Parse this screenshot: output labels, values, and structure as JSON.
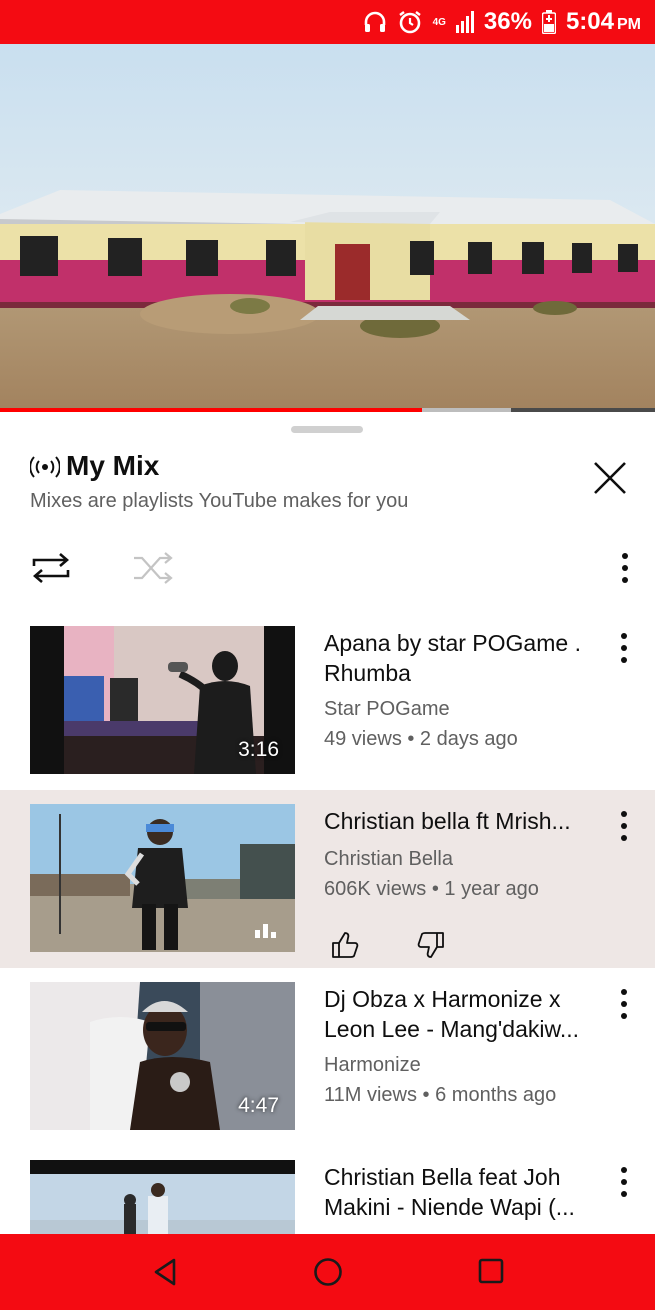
{
  "status_bar": {
    "network": "4G",
    "battery": "36%",
    "time": "5:04",
    "ampm": "PM",
    "icons": [
      "headphones-icon",
      "alarm-icon",
      "signal-icon",
      "battery-charging-icon"
    ]
  },
  "player": {
    "progress": 0.645,
    "buffered_to": 0.78,
    "colors": {
      "progress": "#ff0000",
      "accent_bar": "#f40b12"
    }
  },
  "mix": {
    "title": "My Mix",
    "subtitle": "Mixes are playlists YouTube makes for you",
    "icons": [
      "broadcast-icon",
      "close-icon",
      "repeat-icon",
      "shuffle-icon",
      "more-vert-icon"
    ]
  },
  "playlist": [
    {
      "title": "Apana by star POGame . Rhumba",
      "channel": "Star POGame",
      "meta": "49 views • 2 days ago",
      "duration": "3:16",
      "active": false
    },
    {
      "title": "Christian bella ft Mrish...",
      "channel": "Christian Bella",
      "meta": "606K views • 1 year ago",
      "duration": "",
      "active": true
    },
    {
      "title": "Dj Obza x Harmonize x Leon Lee - Mang'dakiw...",
      "channel": "Harmonize",
      "meta": "11M views • 6 months ago",
      "duration": "4:47",
      "active": false
    },
    {
      "title": "Christian Bella feat Joh Makini - Niende Wapi (...",
      "channel": "",
      "meta": "",
      "duration": "",
      "active": false
    }
  ],
  "nav_bar": {
    "icons": [
      "back-icon",
      "home-icon",
      "recents-icon"
    ]
  }
}
